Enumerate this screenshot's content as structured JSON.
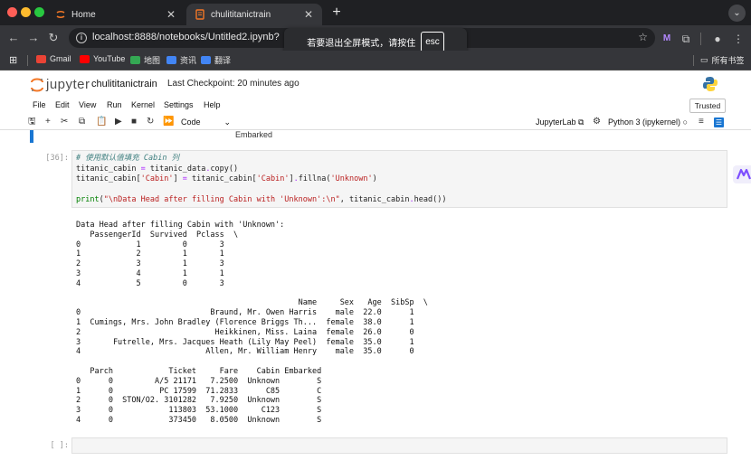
{
  "browser": {
    "tabs": [
      {
        "title": "Home",
        "active": false
      },
      {
        "title": "chulititanictrain",
        "active": true
      }
    ],
    "url": "localhost:8888/notebooks/Untitled2.ipynb?",
    "fullscreen_toast": {
      "text": "若要退出全屏模式，请按住",
      "key": "esc"
    },
    "bookmarks": [
      {
        "label": "Gmail",
        "color": "#ea4335"
      },
      {
        "label": "YouTube",
        "color": "#ff0000"
      },
      {
        "label": "地图",
        "color": "#34a853"
      },
      {
        "label": "资讯",
        "color": "#4285f4"
      },
      {
        "label": "翻译",
        "color": "#4285f4"
      }
    ],
    "all_bookmarks": "所有书签"
  },
  "jupyter": {
    "logo_text": "jupyter",
    "notebook_name": "chulititanictrain",
    "checkpoint": "Last Checkpoint: 20 minutes ago",
    "menus": [
      "File",
      "Edit",
      "View",
      "Run",
      "Kernel",
      "Settings",
      "Help"
    ],
    "trusted": "Trusted",
    "cell_type": "Code",
    "jupyterlab_link": "JupyterLab",
    "kernel_name": "Python 3 (ipykernel)"
  },
  "notebook": {
    "prev_output_tail": "Embarked",
    "cell": {
      "prompt": "[36]:",
      "lines": [
        [
          {
            "t": "# 使用默认值填充 Cabin 列",
            "c": "cm"
          }
        ],
        [
          {
            "t": "titanic_cabin "
          },
          {
            "t": "=",
            "c": "op"
          },
          {
            "t": " titanic_data"
          },
          {
            "t": ".",
            "c": "op"
          },
          {
            "t": "copy()"
          }
        ],
        [
          {
            "t": "titanic_cabin["
          },
          {
            "t": "'Cabin'",
            "c": "str"
          },
          {
            "t": "] "
          },
          {
            "t": "=",
            "c": "op"
          },
          {
            "t": " titanic_cabin["
          },
          {
            "t": "'Cabin'",
            "c": "str"
          },
          {
            "t": "]"
          },
          {
            "t": ".",
            "c": "op"
          },
          {
            "t": "fillna("
          },
          {
            "t": "'Unknown'",
            "c": "str"
          },
          {
            "t": ")"
          }
        ],
        [
          {
            "t": ""
          }
        ],
        [
          {
            "t": "print",
            "c": "fn"
          },
          {
            "t": "("
          },
          {
            "t": "\"\\nData Head after filling Cabin with 'Unknown':\\n\"",
            "c": "str"
          },
          {
            "t": ", titanic_cabin"
          },
          {
            "t": ".",
            "c": "op"
          },
          {
            "t": "head())"
          }
        ]
      ]
    },
    "output_lines": [
      "Data Head after filling Cabin with 'Unknown':",
      "   PassengerId  Survived  Pclass  \\",
      "0            1         0       3   ",
      "1            2         1       1   ",
      "2            3         1       3   ",
      "3            4         1       1   ",
      "4            5         0       3   ",
      "",
      "                                                Name     Sex   Age  SibSp  \\",
      "0                            Braund, Mr. Owen Harris    male  22.0      1   ",
      "1  Cumings, Mrs. John Bradley (Florence Briggs Th...  female  38.0      1   ",
      "2                             Heikkinen, Miss. Laina  female  26.0      0   ",
      "3       Futrelle, Mrs. Jacques Heath (Lily May Peel)  female  35.0      1   ",
      "4                           Allen, Mr. William Henry    male  35.0      0   ",
      "",
      "   Parch            Ticket     Fare    Cabin Embarked  ",
      "0      0         A/5 21171   7.2500  Unknown        S  ",
      "1      0          PC 17599  71.2833      C85        C  ",
      "2      0  STON/O2. 3101282   7.9250  Unknown        S  ",
      "3      0            113803  53.1000     C123        S  ",
      "4      0            373450   8.0500  Unknown        S  "
    ],
    "empty_prompt": "[ ]:"
  },
  "colors": {
    "accent": "#1976d2",
    "chrome_dark": "#35363a",
    "jupyter_orange": "#f37726"
  }
}
